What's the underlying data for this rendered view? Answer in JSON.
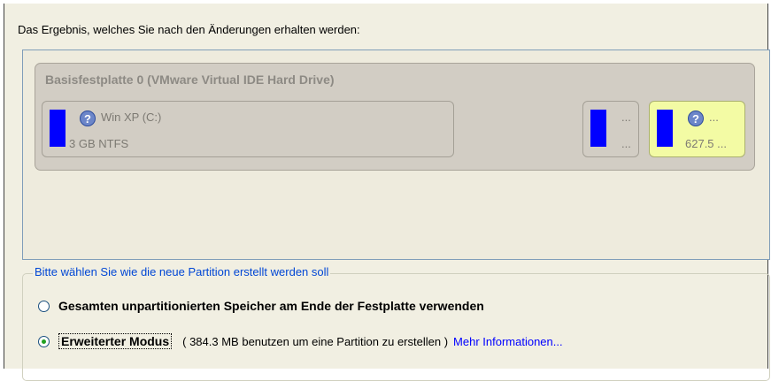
{
  "result_label": "Das Ergebnis, welches Sie nach den Änderungen erhalten werden:",
  "disk": {
    "title": "Basisfestplatte 0 (VMware Virtual IDE Hard Drive)",
    "partitions": [
      {
        "name": "Win XP (C:)",
        "info": "3 GB NTFS",
        "color": "#0000ff"
      },
      {
        "name": "...",
        "info": "...",
        "color": "#0000ff"
      },
      {
        "name": "...",
        "info": "627.5 ...",
        "color": "#0000ff",
        "highlight": "#f3fba4"
      }
    ]
  },
  "group": {
    "legend": "Bitte wählen Sie wie die neue Partition erstellt werden soll",
    "options": [
      {
        "label": "Gesamten unpartitionierten Speicher am Ende der Festplatte verwenden",
        "selected": false
      },
      {
        "label": "Erweiterter Modus",
        "selected": true,
        "hint": "( 384.3 MB benutzen um eine Partition zu erstellen )",
        "link": "Mehr Informationen..."
      }
    ]
  }
}
